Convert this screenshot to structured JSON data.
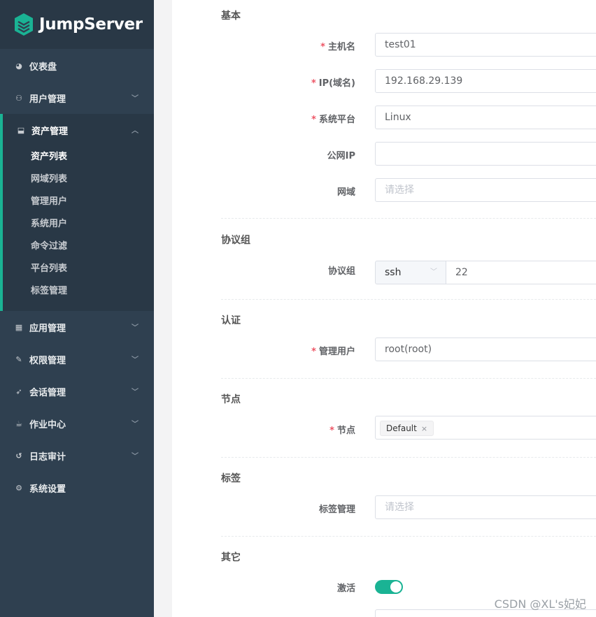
{
  "app": {
    "logo_text": "JumpServer"
  },
  "sidebar": {
    "items": [
      {
        "label": "仪表盘",
        "icon": "dashboard-icon"
      },
      {
        "label": "用户管理",
        "icon": "users-icon",
        "expandable": true
      },
      {
        "label": "资产管理",
        "icon": "inbox-icon",
        "expandable": true,
        "open": true
      },
      {
        "label": "应用管理",
        "icon": "grid-icon",
        "expandable": true
      },
      {
        "label": "权限管理",
        "icon": "edit-icon",
        "expandable": true
      },
      {
        "label": "会话管理",
        "icon": "rocket-icon",
        "expandable": true
      },
      {
        "label": "作业中心",
        "icon": "coffee-icon",
        "expandable": true
      },
      {
        "label": "日志审计",
        "icon": "history-icon",
        "expandable": true
      },
      {
        "label": "系统设置",
        "icon": "gears-icon"
      }
    ],
    "asset_submenu": [
      {
        "label": "资产列表",
        "active": true
      },
      {
        "label": "网域列表"
      },
      {
        "label": "管理用户"
      },
      {
        "label": "系统用户"
      },
      {
        "label": "命令过滤"
      },
      {
        "label": "平台列表"
      },
      {
        "label": "标签管理"
      }
    ]
  },
  "form": {
    "sections": {
      "basic": "基本",
      "protocols": "协议组",
      "auth": "认证",
      "node": "节点",
      "labels": "标签",
      "other": "其它"
    },
    "hostname": {
      "label": "主机名",
      "required": true,
      "value": "test01"
    },
    "ip": {
      "label": "IP(域名)",
      "required": true,
      "value": "192.168.29.139"
    },
    "platform": {
      "label": "系统平台",
      "required": true,
      "value": "Linux"
    },
    "public_ip": {
      "label": "公网IP",
      "value": ""
    },
    "domain": {
      "label": "网域",
      "placeholder": "请选择"
    },
    "protocol": {
      "label": "协议组",
      "name": "ssh",
      "port": "22"
    },
    "admin_user": {
      "label": "管理用户",
      "required": true,
      "value": "root(root)"
    },
    "nodes": {
      "label": "节点",
      "required": true,
      "tag": "Default",
      "tag_close": "×"
    },
    "labels_field": {
      "label": "标签管理",
      "placeholder": "请选择"
    },
    "active": {
      "label": "激活",
      "value": true
    }
  },
  "watermark": "CSDN @XL's妃妃",
  "colors": {
    "sidebar_bg": "#2f4050",
    "accent": "#1ab394",
    "required": "#ed5565"
  }
}
